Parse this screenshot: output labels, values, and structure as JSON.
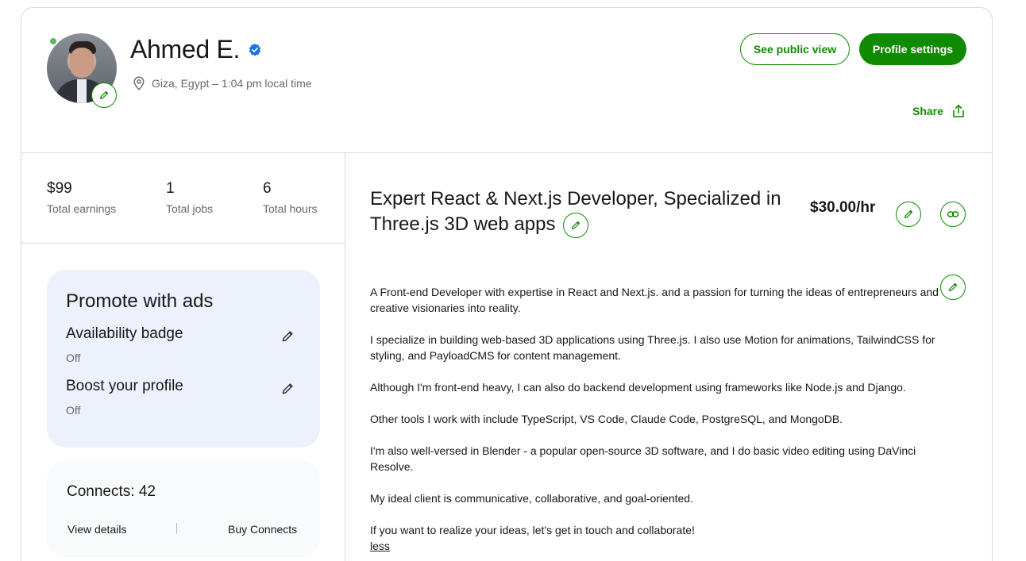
{
  "profile": {
    "name": "Ahmed E.",
    "location": "Giza, Egypt – 1:04 pm local time",
    "online": true
  },
  "header": {
    "public_view_label": "See public view",
    "settings_label": "Profile settings",
    "share_label": "Share"
  },
  "stats": [
    {
      "value": "$99",
      "label": "Total earnings"
    },
    {
      "value": "1",
      "label": "Total jobs"
    },
    {
      "value": "6",
      "label": "Total hours"
    }
  ],
  "promote": {
    "title": "Promote with ads",
    "items": [
      {
        "title": "Availability badge",
        "status": "Off"
      },
      {
        "title": "Boost your profile",
        "status": "Off"
      }
    ]
  },
  "connects": {
    "title": "Connects: 42",
    "view_details": "View details",
    "buy": "Buy Connects"
  },
  "main": {
    "title": "Expert React & Next.js Developer, Specialized in Three.js 3D web apps",
    "rate": "$30.00/hr",
    "overview": [
      "A Front-end Developer with expertise in React and Next.js. and a passion for turning the ideas of entrepreneurs and creative visionaries into reality.",
      "I specialize in building web-based 3D applications using Three.js. I also use Motion for animations, TailwindCSS for styling, and PayloadCMS for content management.",
      "Although I'm front-end heavy, I can also do backend development using frameworks like Node.js and Django.",
      "Other tools I work with include TypeScript, VS Code, Claude Code, PostgreSQL, and MongoDB.",
      "I'm also well-versed in Blender - a popular open-source 3D software, and I do basic video editing using DaVinci Resolve.",
      "My ideal client is communicative, collaborative, and goal-oriented.",
      "If you want to realize your ideas, let's get in touch and collaborate!"
    ],
    "less_label": "less"
  },
  "colors": {
    "accent": "#108a00",
    "promo_bg": "#edf1fb",
    "connects_bg": "#f9fafb",
    "verified": "#1a73e8"
  }
}
